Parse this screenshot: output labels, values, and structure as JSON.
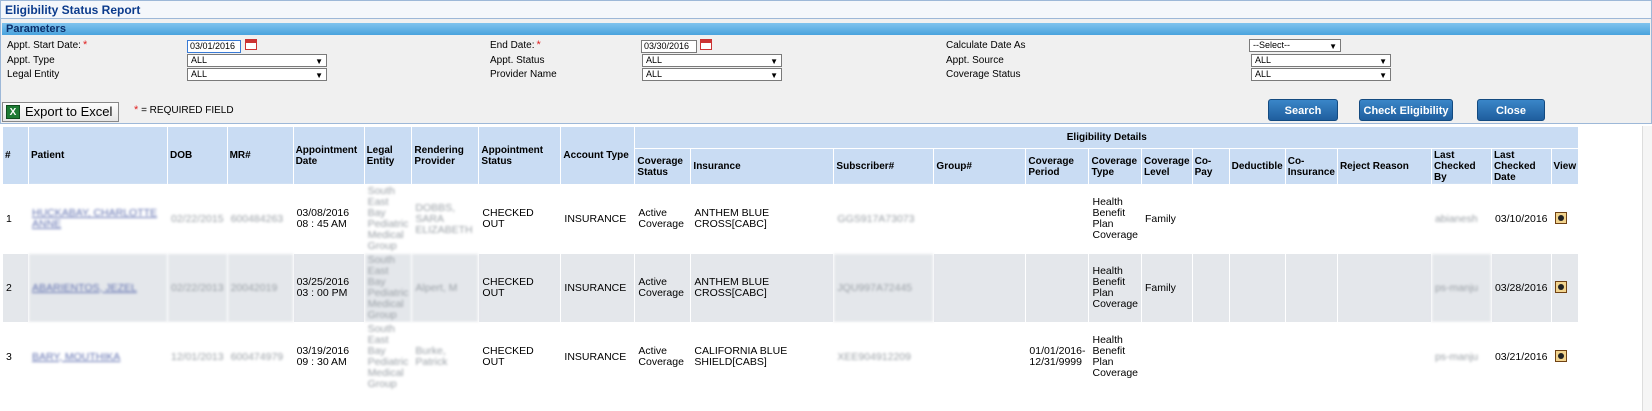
{
  "title": "Eligibility Status Report",
  "params": {
    "header": "Parameters",
    "start_date_label": "Appt. Start Date:",
    "start_date": "03/01/2016",
    "end_date_label": "End Date:",
    "end_date": "03/30/2016",
    "calc_date_label": "Calculate Date As",
    "calc_date_value": "--Select--",
    "appt_type_label": "Appt. Type",
    "appt_type_value": "ALL",
    "appt_status_label": "Appt. Status",
    "appt_status_value": "ALL",
    "appt_source_label": "Appt. Source",
    "appt_source_value": "ALL",
    "legal_entity_label": "Legal Entity",
    "legal_entity_value": "ALL",
    "provider_name_label": "Provider Name",
    "provider_name_value": "ALL",
    "coverage_status_label": "Coverage Status",
    "coverage_status_value": "ALL",
    "required_marker": "*"
  },
  "toolbar": {
    "export_label": "Export to Excel",
    "required_note": "= REQUIRED FIELD",
    "search_label": "Search",
    "check_label": "Check Eligibility",
    "close_label": "Close"
  },
  "table": {
    "group_header": "Eligibility Details",
    "headers": {
      "num": "#",
      "patient": "Patient",
      "dob": "DOB",
      "mr": "MR#",
      "appt_date": "Appointment Date",
      "legal_entity": "Legal Entity",
      "rendering_provider": "Rendering Provider",
      "appt_status": "Appointment Status",
      "account_type": "Account Type",
      "coverage_status": "Coverage Status",
      "insurance": "Insurance",
      "subscriber": "Subscriber#",
      "group": "Group#",
      "coverage_period": "Coverage Period",
      "coverage_type": "Coverage Type",
      "coverage_level": "Coverage Level",
      "copay": "Co-Pay",
      "deductible": "Deductible",
      "coinsurance": "Co-Insurance",
      "reject_reason": "Reject Reason",
      "last_checked_by": "Last Checked By",
      "last_checked_date": "Last Checked Date",
      "view": "View"
    },
    "rows": [
      {
        "num": "1",
        "patient": "HUCKABAY, CHARLOTTE ANNE",
        "dob": "02/22/2015",
        "mr": "600484263",
        "appt_date": "03/08/2016 08 : 45 AM",
        "legal_entity": "South East Bay Pediatric Medical Group",
        "rendering_provider": "DOBBS, SARA ELIZABETH",
        "appt_status": "CHECKED OUT",
        "account_type": "INSURANCE",
        "coverage_status": "Active Coverage",
        "insurance": "ANTHEM BLUE CROSS[CABC]",
        "subscriber": "GGS917A73073",
        "group": "",
        "coverage_period": "",
        "coverage_type": "Health Benefit Plan Coverage",
        "coverage_level": "Family",
        "copay": "",
        "deductible": "",
        "coinsurance": "",
        "reject_reason": "",
        "last_checked_by": "abianesh",
        "last_checked_date": "03/10/2016"
      },
      {
        "num": "2",
        "patient": "ABARIENTOS, JEZEL",
        "dob": "02/22/2013",
        "mr": "20042019",
        "appt_date": "03/25/2016 03 : 00 PM",
        "legal_entity": "South East Bay Pediatric Medical Group",
        "rendering_provider": "Alpert, M",
        "appt_status": "CHECKED OUT",
        "account_type": "INSURANCE",
        "coverage_status": "Active Coverage",
        "insurance": "ANTHEM BLUE CROSS[CABC]",
        "subscriber": "JQU997A72445",
        "group": "",
        "coverage_period": "",
        "coverage_type": "Health Benefit Plan Coverage",
        "coverage_level": "Family",
        "copay": "",
        "deductible": "",
        "coinsurance": "",
        "reject_reason": "",
        "last_checked_by": "ps-manju",
        "last_checked_date": "03/28/2016"
      },
      {
        "num": "3",
        "patient": "BARY, MOUTHIKA",
        "dob": "12/01/2013",
        "mr": "600474979",
        "appt_date": "03/19/2016 09 : 30 AM",
        "legal_entity": "South East Bay Pediatric Medical Group",
        "rendering_provider": "Burke, Patrick",
        "appt_status": "CHECKED OUT",
        "account_type": "INSURANCE",
        "coverage_status": "Active Coverage",
        "insurance": "CALIFORNIA BLUE SHIELD[CABS]",
        "subscriber": "XEE904912209",
        "group": "",
        "coverage_period": "01/01/2016- 12/31/9999",
        "coverage_type": "Health Benefit Plan Coverage",
        "coverage_level": "",
        "copay": "",
        "deductible": "",
        "coinsurance": "",
        "reject_reason": "",
        "last_checked_by": "ps-manju",
        "last_checked_date": "03/21/2016"
      }
    ]
  }
}
